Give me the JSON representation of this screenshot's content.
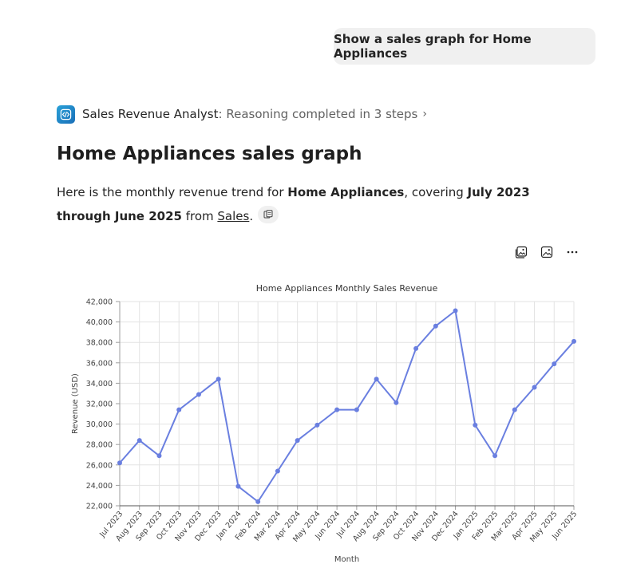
{
  "user_message": "Show a sales graph for Home Appliances",
  "agent": {
    "name": "Sales Revenue Analyst",
    "separator": ":",
    "status": "Reasoning completed in 3 steps",
    "icon": "code-icon"
  },
  "response": {
    "title": "Home Appliances sales graph",
    "text_1": "Here is the monthly revenue trend for ",
    "bold_1": "Home Appliances",
    "text_2": ", covering ",
    "bold_2": "July 2023 through June 2025",
    "text_3": " from ",
    "link": "Sales",
    "text_4": "."
  },
  "toolbar": [
    "copy-image-icon",
    "image-icon",
    "more-icon"
  ],
  "chart_data": {
    "type": "line",
    "title": "Home Appliances Monthly Sales Revenue",
    "xlabel": "Month",
    "ylabel": "Revenue (USD)",
    "ylim": [
      22000,
      42000
    ],
    "yticks": [
      22000,
      24000,
      26000,
      28000,
      30000,
      32000,
      34000,
      36000,
      38000,
      40000,
      42000
    ],
    "ytick_labels": [
      "22,000",
      "24,000",
      "26,000",
      "28,000",
      "30,000",
      "32,000",
      "34,000",
      "36,000",
      "38,000",
      "40,000",
      "42,000"
    ],
    "grid": true,
    "color": "#6a7fe0",
    "categories": [
      "Jul 2023",
      "Aug 2023",
      "Sep 2023",
      "Oct 2023",
      "Nov 2023",
      "Dec 2023",
      "Jan 2024",
      "Feb 2024",
      "Mar 2024",
      "Apr 2024",
      "May 2024",
      "Jun 2024",
      "Jul 2024",
      "Aug 2024",
      "Sep 2024",
      "Oct 2024",
      "Nov 2024",
      "Dec 2024",
      "Jan 2025",
      "Feb 2025",
      "Mar 2025",
      "Apr 2025",
      "May 2025",
      "Jun 2025"
    ],
    "values": [
      26200,
      28400,
      26900,
      31400,
      32900,
      34400,
      23900,
      22400,
      25400,
      28400,
      29900,
      31400,
      31400,
      34400,
      32100,
      37400,
      39600,
      41100,
      29900,
      26900,
      31400,
      33600,
      35900,
      38100
    ]
  }
}
